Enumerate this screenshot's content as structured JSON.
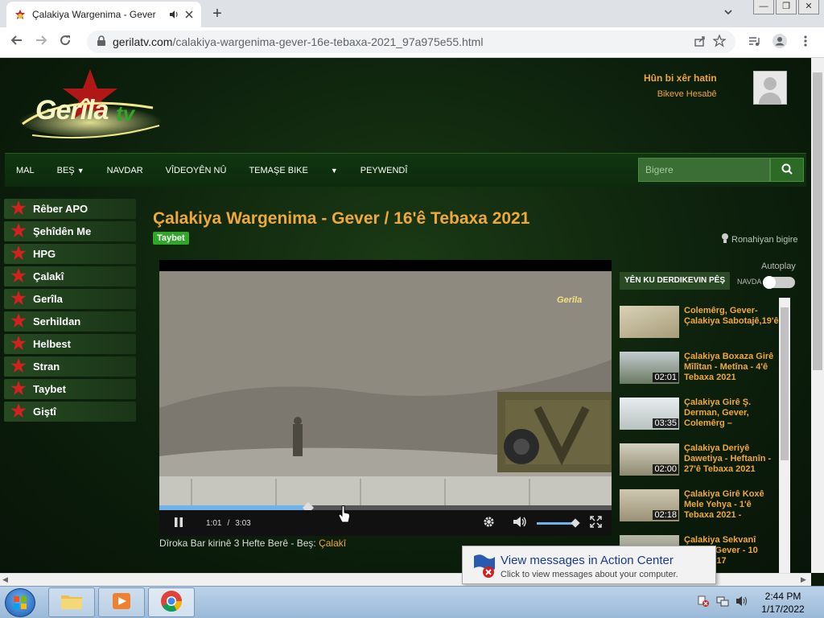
{
  "browser": {
    "tab_title": "Çalakiya Wargenima - Gever",
    "url_host": "gerilatv.com",
    "url_path": "/calakiya-wargenima-gever-16e-tebaxa-2021_97a975e55.html",
    "window_controls": [
      "—",
      "❐",
      "✕"
    ]
  },
  "site": {
    "logo_main": "Gerîla",
    "logo_tv": "tv",
    "login_title": "Hûn bi xêr hatin",
    "login_link": "Bikeve Hesabê"
  },
  "nav": {
    "items": [
      "MAL",
      "BEŞ",
      "NAVDAR",
      "VÎDEOYÊN NÛ",
      "TEMAŞE BIKE",
      "",
      "PEYWENDÎ"
    ],
    "search_placeholder": "Bigere"
  },
  "sidebar": {
    "items": [
      "Rêber APO",
      "Şehîdên Me",
      "HPG",
      "Çalakî",
      "Gerîla",
      "Serhildan",
      "Helbest",
      "Stran",
      "Taybet",
      "Giştî"
    ]
  },
  "video": {
    "title": "Çalakiya Wargenima - Gever / 16'ê Tebaxa 2021",
    "badge": "Taybet",
    "related_link": "Ronahiyan bigire",
    "watermark": "Gerîla",
    "current_time": "1:01",
    "separator": "/",
    "duration": "3:03",
    "progress_fraction": 0.33,
    "volume_fraction": 0.85,
    "info_prefix": "Dîroka Bar kirinê 3 Hefte Berê - Beş:",
    "info_category": "Çalakî"
  },
  "right": {
    "autoplay_label": "Autoplay",
    "nextup_label": "YÊN KU DERDIKEVIN PÊŞ",
    "navda_label": "NAVDA",
    "suggestions": [
      {
        "title": "Colemêrg, Gever-Çalakiya Sabotajê,19'ê",
        "duration": ""
      },
      {
        "title": "Çalakiya Boxaza Girê Mîlîtan - Metîna - 4'ê Tebaxa 2021",
        "duration": "02:01"
      },
      {
        "title": "Çalakiya Girê Ş. Derman, Gever, Colemêrg –",
        "duration": "03:35"
      },
      {
        "title": "Çalakiya Deriyê Dawetiya - Heftanîn - 27'ê Tebaxa 2021",
        "duration": "02:00"
      },
      {
        "title": "Çalakiya Girê Koxê Mele Yehya - 1'ê Tebaxa 2021 -",
        "duration": "02:18"
      },
      {
        "title": "Çalakiya Sekvanî Orman Gever - 10 Adar 2017",
        "duration": ""
      }
    ]
  },
  "notification": {
    "title": "View messages in Action Center",
    "subtitle": "Click to view messages about your computer."
  },
  "taskbar": {
    "time": "2:44 PM",
    "date": "1/17/2022"
  },
  "colors": {
    "accent": "#f0a83a",
    "badge": "#2fa82a",
    "page_bg": "#0c1f0c"
  }
}
